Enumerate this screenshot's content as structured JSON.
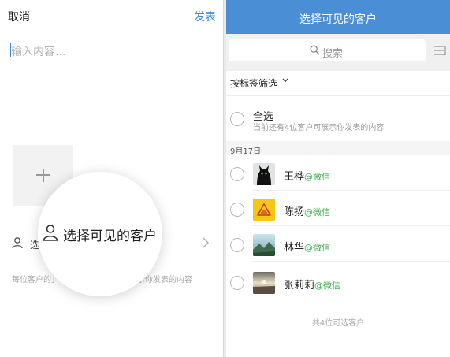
{
  "compose": {
    "cancel_label": "取消",
    "publish_label": "发表",
    "input_placeholder": "输入内容...",
    "visibility_label_partial": "选",
    "hint_left": "每位客户的」",
    "hint_right": "示你发表的内容",
    "magnified_label": "选择可见的客户"
  },
  "picker": {
    "title": "选择可见的客户",
    "search_placeholder": "搜索",
    "tag_filter_label": "按标签筛选",
    "select_all": {
      "title": "全选",
      "subtitle": "当前还有4位客户可展示你发表的内容"
    },
    "date_header": "9月17日",
    "customers": [
      {
        "name": "王桦",
        "source": "@微信",
        "avatar": "black-cat-avatar"
      },
      {
        "name": "陈扬",
        "source": "@微信",
        "avatar": "warning-sign-avatar"
      },
      {
        "name": "林华",
        "source": "@微信",
        "avatar": "landscape-avatar"
      },
      {
        "name": "张莉莉",
        "source": "@微信",
        "avatar": "sunset-avatar"
      }
    ],
    "total_label": "共4位可选客户"
  },
  "colors": {
    "header_blue": "#4a8fd6",
    "link_blue": "#3e8ee0",
    "wechat_green": "#3cb04a"
  }
}
